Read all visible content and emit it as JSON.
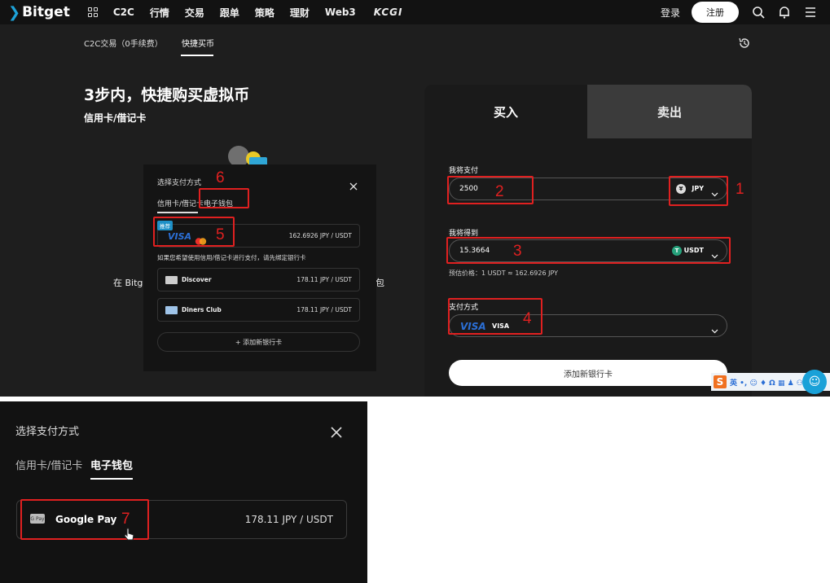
{
  "navbar": {
    "logo": "Bitget",
    "items": [
      "C2C",
      "行情",
      "交易",
      "跟单",
      "策略",
      "理财",
      "Web3",
      "KCGI"
    ],
    "login": "登录",
    "register": "注册"
  },
  "subnav": {
    "tab1": "C2C交易（0手续费）",
    "tab2": "快捷买币"
  },
  "hero": {
    "title": "3步内，快捷购买虚拟币",
    "subtitle": "信用卡/借记卡",
    "ghost_left": "在 Bitge",
    "ghost_right": "包"
  },
  "popup": {
    "title": "选择支付方式",
    "tab_card": "信用卡/借记卡",
    "tab_wallet": "电子钱包",
    "badge": "推荐",
    "visa_label": "VISA",
    "visa_rate": "162.6926 JPY / USDT",
    "hint": "如果您希望使用信用/借记卡进行支付，请先绑定银行卡",
    "cards": [
      {
        "name": "Discover",
        "rate": "178.11 JPY / USDT"
      },
      {
        "name": "Diners Club",
        "rate": "178.11 JPY / USDT"
      }
    ],
    "add_card": "+ 添加新银行卡"
  },
  "panel": {
    "tab_buy": "买入",
    "tab_sell": "卖出",
    "pay_label": "我将支付",
    "pay_value": "2500",
    "pay_currency": "JPY",
    "get_label": "我将得到",
    "get_value": "15.3664",
    "get_currency": "USDT",
    "estimate": "预估价格：1 USDT ≈ 162.6926 JPY",
    "method_label": "支付方式",
    "method_visa": "VISA",
    "method_name": "VISA",
    "add_bank": "添加新银行卡"
  },
  "ime": {
    "logo": "S",
    "mode": "英 •, ☺ ♦ Ω ▦ ♟ ⚇ ⊞"
  },
  "annotations": [
    "1",
    "2",
    "3",
    "4",
    "5",
    "6",
    "7"
  ],
  "bottom": {
    "title": "选择支付方式",
    "tab_card": "信用卡/借记卡",
    "tab_wallet": "电子钱包",
    "wallet_icon": "G Pay",
    "wallet_name": "Google Pay",
    "wallet_rate": "178.11 JPY / USDT"
  },
  "colors": {
    "accent": "#1da2d8",
    "annotation": "#e02020",
    "background": "#1e1e1e"
  }
}
